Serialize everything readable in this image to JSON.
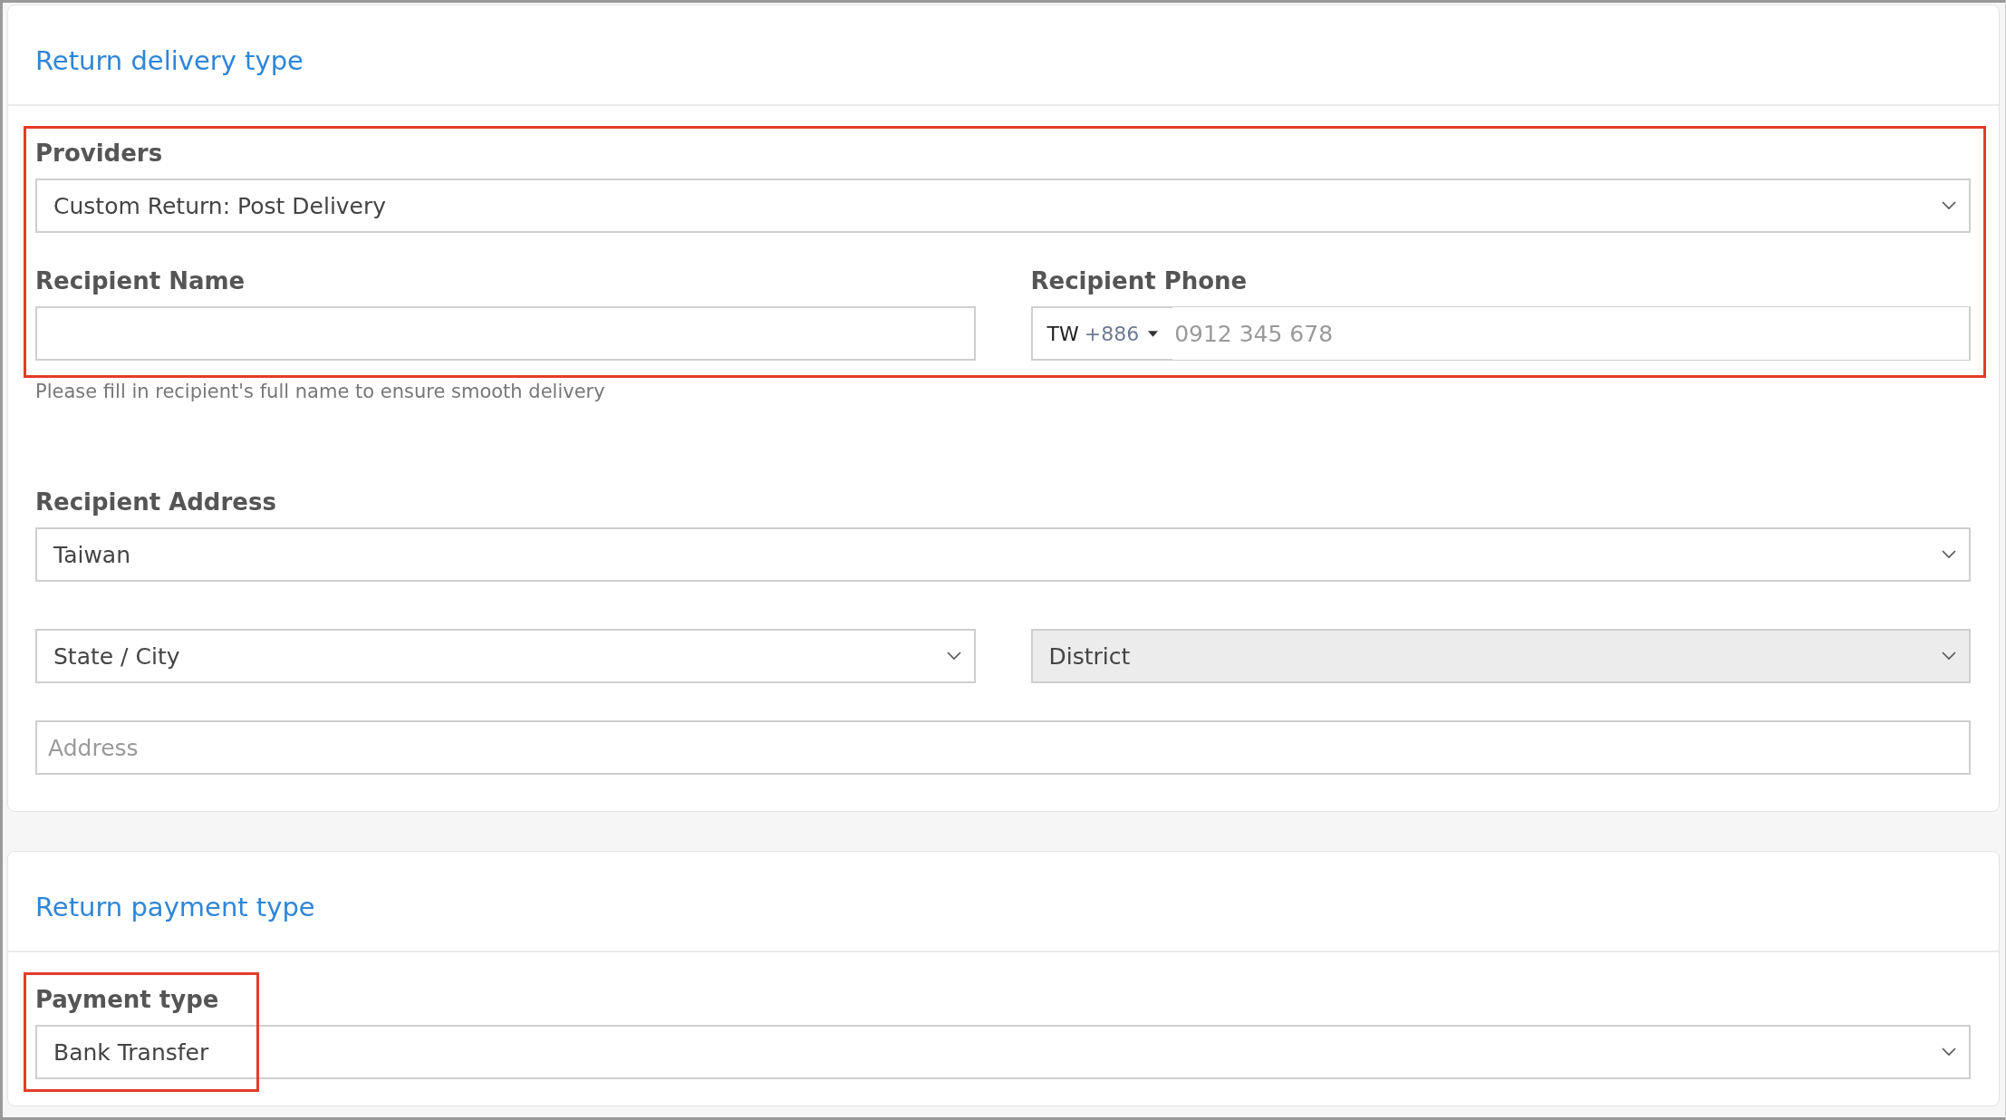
{
  "delivery": {
    "title": "Return delivery type",
    "highlighted": true,
    "providers": {
      "label": "Providers",
      "value": "Custom Return: Post Delivery"
    },
    "recipient_name": {
      "label": "Recipient Name",
      "help_text": "Please fill in recipient's full name to ensure smooth delivery"
    },
    "recipient_phone": {
      "label": "Recipient Phone",
      "country_code": "TW",
      "dial_code": "+886",
      "placeholder": "0912 345 678"
    },
    "recipient_address": {
      "label": "Recipient Address",
      "country": "Taiwan",
      "state": {
        "value": "State / City",
        "disabled": false
      },
      "district": {
        "value": "District",
        "disabled": true
      },
      "address": {
        "placeholder": "Address"
      }
    }
  },
  "payment": {
    "title": "Return payment type",
    "highlighted": true,
    "payment_type": {
      "label": "Payment type",
      "value": "Bank Transfer"
    }
  }
}
